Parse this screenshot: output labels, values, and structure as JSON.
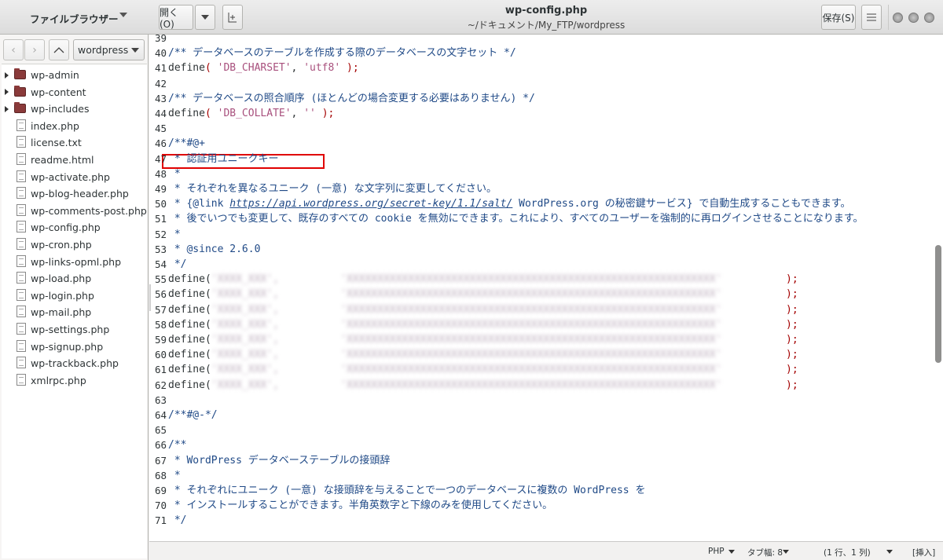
{
  "sidebar": {
    "title": "ファイルブラウザー",
    "location": "wordpress",
    "items": [
      {
        "label": "wp-admin",
        "type": "folder"
      },
      {
        "label": "wp-content",
        "type": "folder"
      },
      {
        "label": "wp-includes",
        "type": "folder"
      },
      {
        "label": "index.php",
        "type": "file"
      },
      {
        "label": "license.txt",
        "type": "file"
      },
      {
        "label": "readme.html",
        "type": "file"
      },
      {
        "label": "wp-activate.php",
        "type": "file"
      },
      {
        "label": "wp-blog-header.php",
        "type": "file"
      },
      {
        "label": "wp-comments-post.php",
        "type": "file"
      },
      {
        "label": "wp-config.php",
        "type": "file"
      },
      {
        "label": "wp-cron.php",
        "type": "file"
      },
      {
        "label": "wp-links-opml.php",
        "type": "file"
      },
      {
        "label": "wp-load.php",
        "type": "file"
      },
      {
        "label": "wp-login.php",
        "type": "file"
      },
      {
        "label": "wp-mail.php",
        "type": "file"
      },
      {
        "label": "wp-settings.php",
        "type": "file"
      },
      {
        "label": "wp-signup.php",
        "type": "file"
      },
      {
        "label": "wp-trackback.php",
        "type": "file"
      },
      {
        "label": "xmlrpc.php",
        "type": "file"
      }
    ]
  },
  "header": {
    "open_label": "開く(O)",
    "title": "wp-config.php",
    "subtitle": "~/ドキュメント/My_FTP/wordpress",
    "save_label": "保存(S)"
  },
  "editor": {
    "lines": [
      {
        "n": "39",
        "text": ""
      },
      {
        "n": "40",
        "text": "/** データベースのテーブルを作成する際のデータベースの文字セット */"
      },
      {
        "n": "41",
        "text": "define( 'DB_CHARSET', 'utf8' );"
      },
      {
        "n": "42",
        "text": ""
      },
      {
        "n": "43",
        "text": "/** データベースの照合順序 (ほとんどの場合変更する必要はありません) */"
      },
      {
        "n": "44",
        "text": "define( 'DB_COLLATE', '' );"
      },
      {
        "n": "45",
        "text": ""
      },
      {
        "n": "46",
        "text": "/**#@+"
      },
      {
        "n": "47",
        "text": " * 認証用ユニークキー"
      },
      {
        "n": "48",
        "text": " *"
      },
      {
        "n": "49",
        "text": " * それぞれを異なるユニーク (一意) な文字列に変更してください。"
      },
      {
        "n": "50",
        "text": " * {@link https://api.wordpress.org/secret-key/1.1/salt/ WordPress.org の秘密鍵サービス} で自動生成することもできます。"
      },
      {
        "n": "51",
        "text": " * 後でいつでも変更して、既存のすべての cookie を無効にできます。これにより、すべてのユーザーを強制的に再ログインさせることになります。"
      },
      {
        "n": "52",
        "text": " *"
      },
      {
        "n": "53",
        "text": " * @since 2.6.0"
      },
      {
        "n": "54",
        "text": " */"
      },
      {
        "n": "55",
        "text": "define("
      },
      {
        "n": "56",
        "text": "define("
      },
      {
        "n": "57",
        "text": "define("
      },
      {
        "n": "58",
        "text": "define("
      },
      {
        "n": "59",
        "text": "define("
      },
      {
        "n": "60",
        "text": "define("
      },
      {
        "n": "61",
        "text": "define("
      },
      {
        "n": "62",
        "text": "define("
      },
      {
        "n": "63",
        "text": ""
      },
      {
        "n": "64",
        "text": "/**#@-*/"
      },
      {
        "n": "65",
        "text": ""
      },
      {
        "n": "66",
        "text": "/**"
      },
      {
        "n": "67",
        "text": " * WordPress データベーステーブルの接頭辞"
      },
      {
        "n": "68",
        "text": " *"
      },
      {
        "n": "69",
        "text": " * それぞれにユニーク (一意) な接頭辞を与えることで一つのデータベースに複数の WordPress を"
      },
      {
        "n": "70",
        "text": " * インストールすることができます。半角英数字と下線のみを使用してください。"
      },
      {
        "n": "71",
        "text": " */"
      }
    ],
    "define_kw": "define(",
    "blurred_end": ");",
    "redacted_mask": "'XXXX_XXX',          'XXXXXXXXXXXXXXXXXXXXXXXXXXXXXXXXXXXXXXXXXXXXXXXXXXXXXXXXXXXX'"
  },
  "status": {
    "language": "PHP",
    "tab_width": "タブ幅: 8",
    "position": "(1 行、1 列)",
    "mode": "[挿入]"
  },
  "colors": {
    "comment": "#204a87",
    "string": "#a8507d",
    "paren": "#a40000",
    "highlight_border": "#e00000"
  }
}
